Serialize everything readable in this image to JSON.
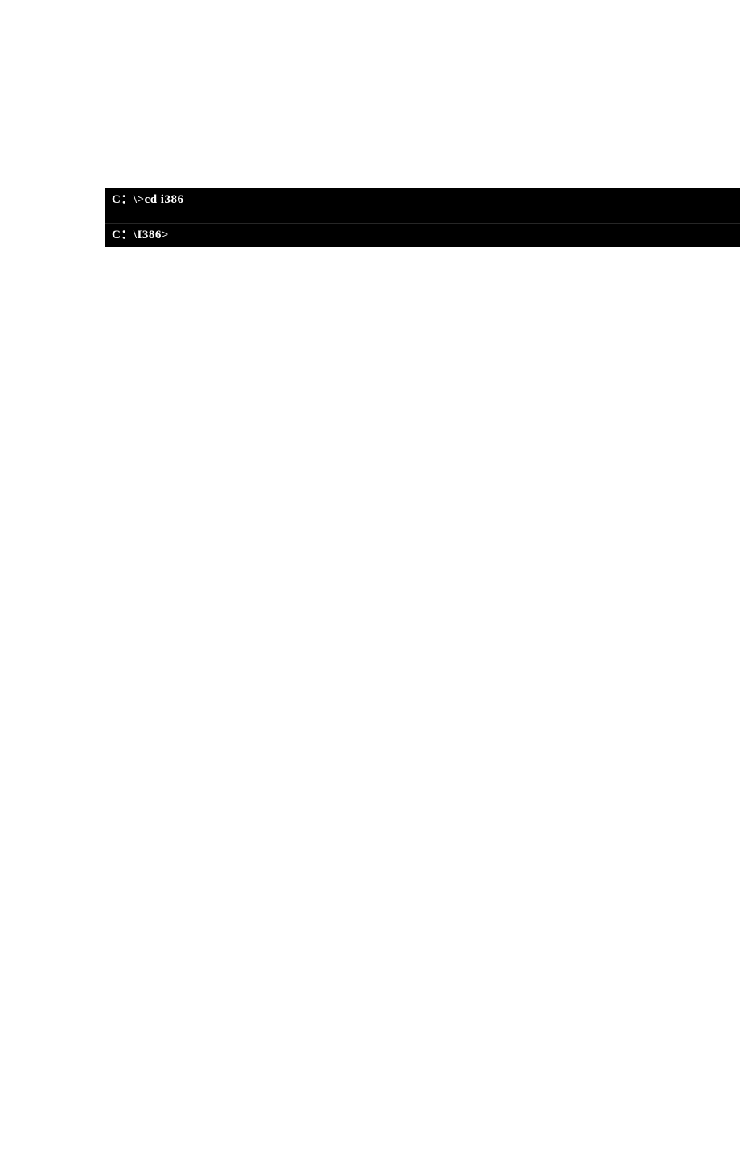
{
  "terminal": {
    "lines": [
      {
        "text": "C：\\>cd i386"
      },
      {
        "text": "C：\\I386>"
      }
    ]
  }
}
